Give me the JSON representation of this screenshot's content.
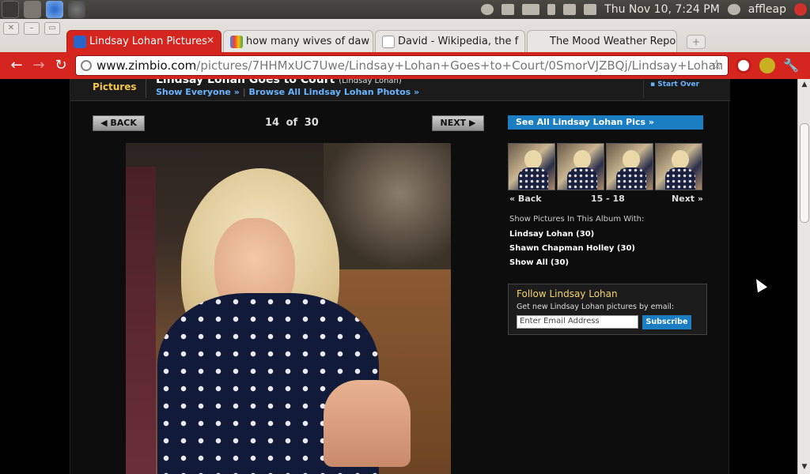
{
  "system": {
    "clock": "Thu Nov 10,  7:24 PM",
    "user": "affleap"
  },
  "browser": {
    "tabs": [
      {
        "title": "Lindsay Lohan Pictures",
        "active": true
      },
      {
        "title": "how many wives of daw",
        "active": false
      },
      {
        "title": "David - Wikipedia, the f",
        "active": false
      },
      {
        "title": "The Mood Weather Repo",
        "active": false
      }
    ],
    "url_host": "www.zimbio.com",
    "url_path": "/pictures/7HHMxUC7Uwe/Lindsay+Lohan+Goes+to+Court/0SmorVJZBQj/Lindsay+Lohan",
    "accent_color": "#d5251f"
  },
  "page": {
    "section": "Pictures",
    "title": "Lindsay Lohan Goes to Court",
    "title_tag": "(Lindsay Lohan)",
    "links": [
      "Show Everyone »",
      "Browse All Lindsay Lohan Photos »"
    ],
    "start_over": "Start Over",
    "pager": {
      "back_label": "BACK",
      "next_label": "NEXT",
      "current": "14",
      "of_word": "of",
      "total": "30"
    },
    "see_all": "See All Lindsay Lohan Pics »",
    "thumb_nav": {
      "back": "« Back",
      "range": "15 - 18",
      "next": "Next »"
    },
    "album": {
      "heading": "Show Pictures In This Album With:",
      "links": [
        "Lindsay Lohan (30)",
        "Shawn Chapman Holley (30)",
        "Show All (30)"
      ]
    },
    "follow": {
      "heading": "Follow Lindsay Lohan",
      "subtitle": "Get new Lindsay Lohan pictures by email:",
      "email_placeholder": "Enter Email Address",
      "subscribe_label": "Subscribe"
    }
  }
}
